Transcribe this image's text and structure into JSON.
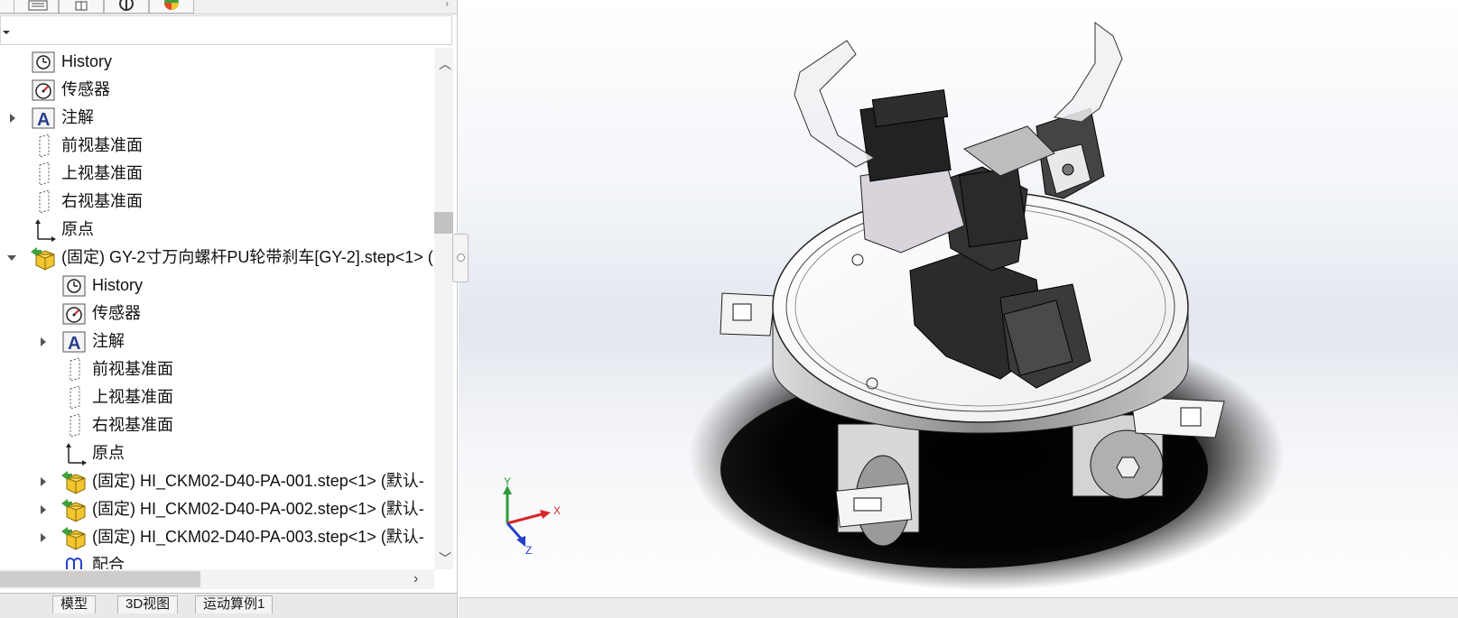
{
  "tabs": [
    {
      "name": "feature-manager-tab",
      "icon": "feature-tree-icon"
    },
    {
      "name": "property-manager-tab",
      "icon": "property-list-icon"
    },
    {
      "name": "configuration-manager-tab",
      "icon": "configuration-icon"
    },
    {
      "name": "dimxpert-tab",
      "icon": "crosshair-icon"
    },
    {
      "name": "display-manager-tab",
      "icon": "color-pie-icon"
    }
  ],
  "tree": {
    "items": [
      {
        "label": "History"
      },
      {
        "label": "传感器"
      },
      {
        "label": "注解"
      },
      {
        "label": "前视基准面"
      },
      {
        "label": "上视基准面"
      },
      {
        "label": "右视基准面"
      },
      {
        "label": "原点"
      },
      {
        "label": "(固定) GY-2寸万向螺杆PU轮带刹车[GY-2].step<1> ("
      },
      {
        "label": "History"
      },
      {
        "label": "传感器"
      },
      {
        "label": "注解"
      },
      {
        "label": "前视基准面"
      },
      {
        "label": "上视基准面"
      },
      {
        "label": "右视基准面"
      },
      {
        "label": "原点"
      },
      {
        "label": "(固定) HI_CKM02-D40-PA-001.step<1> (默认-"
      },
      {
        "label": "(固定) HI_CKM02-D40-PA-002.step<1> (默认-"
      },
      {
        "label": "(固定) HI_CKM02-D40-PA-003.step<1> (默认-"
      },
      {
        "label": "配合"
      }
    ]
  },
  "bottom_tabs": [
    "模型",
    "3D视图",
    "运动算例1"
  ],
  "triad": {
    "x_label": "X",
    "y_label": "Y",
    "z_label": "Z"
  },
  "colors": {
    "x_axis": "#d8262b",
    "y_axis": "#2f9a3a",
    "z_axis": "#2541c8",
    "tree_icon_yellow": "#f2c531",
    "tree_icon_green": "#3da13b"
  }
}
